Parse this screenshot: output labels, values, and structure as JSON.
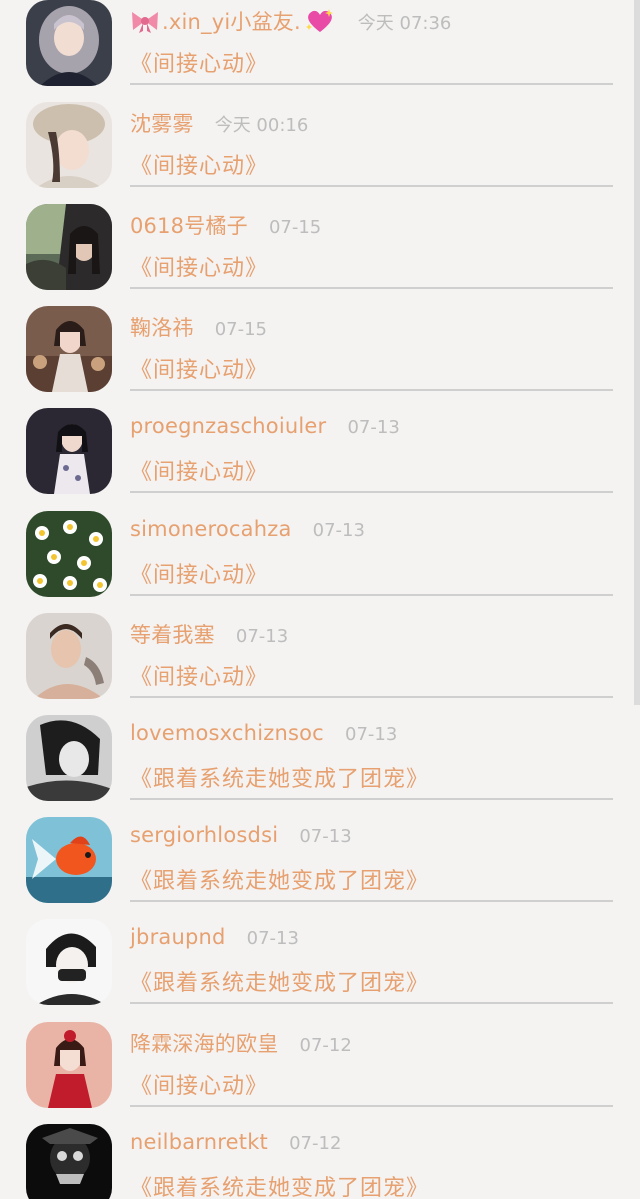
{
  "items": [
    {
      "name": "🎀.xin_yi小盆友.💖",
      "name_text": ".xin_yi小盆友.",
      "time": "今天 07:36",
      "book": "《间接心动》",
      "avatar": "avatar-girl-grey-hair"
    },
    {
      "name": "沈雾雾",
      "time": "今天 00:16",
      "book": "《间接心动》",
      "avatar": "avatar-girl-fur-hat"
    },
    {
      "name": "0618号橘子",
      "time": "07-15",
      "book": "《间接心动》",
      "avatar": "avatar-girl-in-car"
    },
    {
      "name": "鞠洛祎",
      "time": "07-15",
      "book": "《间接心动》",
      "avatar": "avatar-girl-flowers"
    },
    {
      "name": "proegnzaschoiuler",
      "time": "07-13",
      "book": "《间接心动》",
      "avatar": "avatar-girl-qipao"
    },
    {
      "name": "simonerocahza",
      "time": "07-13",
      "book": "《间接心动》",
      "avatar": "avatar-daisies"
    },
    {
      "name": "等着我塞",
      "time": "07-13",
      "book": "《间接心动》",
      "avatar": "avatar-man-portrait"
    },
    {
      "name": "lovemosxchiznsoc",
      "time": "07-13",
      "book": "《跟着系统走她变成了团宠》",
      "avatar": "avatar-girl-black-white"
    },
    {
      "name": "sergiorhlosdsi",
      "time": "07-13",
      "book": "《跟着系统走她变成了团宠》",
      "avatar": "avatar-goldfish"
    },
    {
      "name": "jbraupnd",
      "time": "07-13",
      "book": "《跟着系统走她变成了团宠》",
      "avatar": "avatar-masked-boy-sketch"
    },
    {
      "name": "降霖深海的欧皇",
      "time": "07-12",
      "book": "《间接心动》",
      "avatar": "avatar-girl-red-dress"
    },
    {
      "name": "neilbarnretkt",
      "time": "07-12",
      "book": "《跟着系统走她变成了团宠》",
      "avatar": "avatar-skull-dark"
    }
  ],
  "colors": {
    "accent": "#e7a06f",
    "muted": "#bdbdbd",
    "divider": "#cfcfcf",
    "background": "#f4f3f2"
  }
}
